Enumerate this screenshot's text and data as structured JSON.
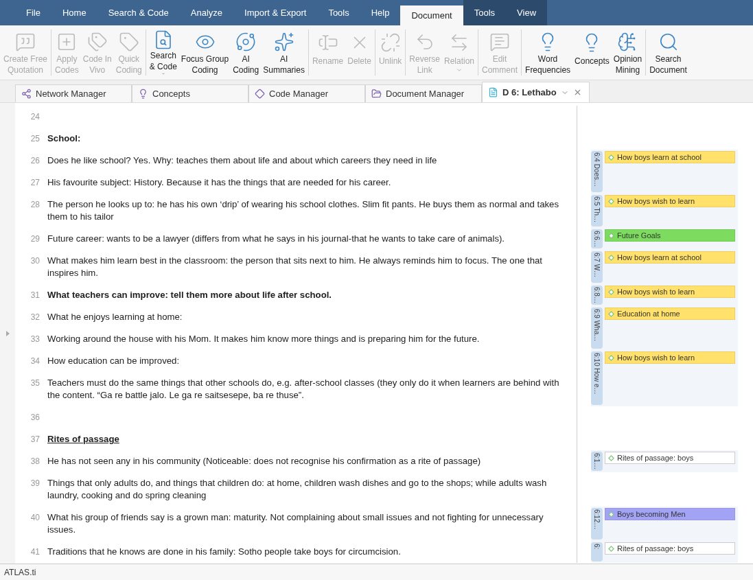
{
  "menu": [
    {
      "label": "File",
      "selected": false,
      "context": false
    },
    {
      "label": "Home",
      "selected": false,
      "context": false
    },
    {
      "label": "Search & Code",
      "selected": false,
      "context": false
    },
    {
      "label": "Analyze",
      "selected": false,
      "context": false
    },
    {
      "label": "Import & Export",
      "selected": false,
      "context": false
    },
    {
      "label": "Tools",
      "selected": false,
      "context": false
    },
    {
      "label": "Help",
      "selected": false,
      "context": false
    },
    {
      "label": "Document",
      "selected": true,
      "context": true
    },
    {
      "label": "Tools",
      "selected": false,
      "context": true
    },
    {
      "label": "View",
      "selected": false,
      "context": true
    }
  ],
  "ribbon": [
    {
      "buttons": [
        {
          "lines": [
            "Create Free",
            "Quotation"
          ],
          "disabled": true,
          "dropdown": false
        }
      ]
    },
    {
      "buttons": [
        {
          "lines": [
            "Apply",
            "Codes"
          ],
          "disabled": true,
          "dropdown": false
        },
        {
          "lines": [
            "Code In",
            "Vivo"
          ],
          "disabled": true,
          "dropdown": false
        },
        {
          "lines": [
            "Quick",
            "Coding"
          ],
          "disabled": true,
          "dropdown": false
        }
      ]
    },
    {
      "buttons": [
        {
          "lines": [
            "Search",
            "& Code"
          ],
          "disabled": false,
          "dropdown": true
        },
        {
          "lines": [
            "Focus Group",
            "Coding"
          ],
          "disabled": false,
          "dropdown": false
        },
        {
          "lines": [
            "AI",
            "Coding"
          ],
          "disabled": false,
          "dropdown": false
        },
        {
          "lines": [
            "AI",
            "Summaries"
          ],
          "disabled": false,
          "dropdown": false
        }
      ]
    },
    {
      "buttons": [
        {
          "lines": [
            "Rename"
          ],
          "disabled": true,
          "dropdown": false
        },
        {
          "lines": [
            "Delete"
          ],
          "disabled": true,
          "dropdown": false
        }
      ]
    },
    {
      "buttons": [
        {
          "lines": [
            "Unlink"
          ],
          "disabled": true,
          "dropdown": false
        }
      ]
    },
    {
      "buttons": [
        {
          "lines": [
            "Reverse",
            "Link"
          ],
          "disabled": true,
          "dropdown": false
        },
        {
          "lines": [
            "Relation"
          ],
          "disabled": true,
          "dropdown": true
        }
      ]
    },
    {
      "buttons": [
        {
          "lines": [
            "Edit",
            "Comment"
          ],
          "disabled": true,
          "dropdown": false
        }
      ]
    },
    {
      "buttons": [
        {
          "lines": [
            "Word",
            "Frequencies"
          ],
          "disabled": false,
          "dropdown": false
        },
        {
          "lines": [
            "Concepts"
          ],
          "disabled": false,
          "dropdown": false
        },
        {
          "lines": [
            "Opinion",
            "Mining"
          ],
          "disabled": false,
          "dropdown": false
        }
      ]
    },
    {
      "buttons": [
        {
          "lines": [
            "Search",
            "Document"
          ],
          "disabled": false,
          "dropdown": false
        }
      ]
    }
  ],
  "doc_tabs": [
    {
      "label": "Network Manager",
      "selected": false
    },
    {
      "label": "Concepts",
      "selected": false
    },
    {
      "label": "Code Manager",
      "selected": false
    },
    {
      "label": "Document Manager",
      "selected": false
    },
    {
      "label": "D 6: Lethabo",
      "selected": true
    }
  ],
  "segments": [
    {
      "lines": [
        {
          "number": "24"
        },
        {
          "number": "25",
          "text": "School:",
          "kind": "emphasis"
        }
      ]
    },
    {
      "quotation": {
        "label": "6:4 Does…",
        "code": "How boys learn at school",
        "color": "#ffe16b"
      },
      "lines": [
        {
          "number": "26",
          "text": "Does he like school? Yes. Why: teaches them about life and about which careers they need in life",
          "kind": "plain"
        },
        {
          "number": "27",
          "text": "His favourite subject: History. Because it has the things that are needed for his career.",
          "kind": "plain"
        }
      ]
    },
    {
      "quotation": {
        "label": "6:5 Th…",
        "code": "How boys wish to learn",
        "color": "#ffe16b"
      },
      "lines": [
        {
          "number": "28",
          "text": "The person he looks up to: he has his own ‘drip’ of wearing his school clothes. Slim fit pants. He buys them as normal and takes them to his tailor",
          "kind": "plain"
        }
      ]
    },
    {
      "quotation": {
        "label": "6:6…",
        "code": "Future Goals",
        "color": "#7ddc5f"
      },
      "lines": [
        {
          "number": "29",
          "text": "Future career: wants to be a lawyer (differs from what he says in his journal-that he wants to take care of animals).",
          "kind": "plain"
        }
      ]
    },
    {
      "quotation": {
        "label": "6:7 W…",
        "code": "How boys learn at school",
        "color": "#ffe16b"
      },
      "lines": [
        {
          "number": "30",
          "text": "What makes him learn best in the classroom: the person that sits next to him. He always reminds him to focus. The one that inspires him.",
          "kind": "plain"
        }
      ]
    },
    {
      "quotation": {
        "label": "6:8…",
        "code": "How boys wish to learn",
        "color": "#ffe16b"
      },
      "lines": [
        {
          "number": "31",
          "text": "What teachers can improve: tell them more about life after school.",
          "kind": "emphasis"
        }
      ]
    },
    {
      "quotation": {
        "label": "6:9 Wha…",
        "code": "Education at home",
        "color": "#ffe16b"
      },
      "lines": [
        {
          "number": "32",
          "text": "What he enjoys learning at home:",
          "kind": "plain"
        },
        {
          "number": "33",
          "text": "Working around the house with his Mom. It makes him know more things and is preparing him for the future.",
          "kind": "plain"
        }
      ]
    },
    {
      "quotation": {
        "label": "6:10 How e…",
        "code": "How boys wish to learn",
        "color": "#ffe16b"
      },
      "lines": [
        {
          "number": "34",
          "text": "How education can be improved:",
          "kind": "plain"
        },
        {
          "number": "35",
          "text": "Teachers must do the same things that other schools do, e.g. after-school classes (they only do it when learners are behind with the content. “Ga re battle jalo. Le ga re saitsesepe, ba re thuse”.",
          "kind": "plain"
        }
      ]
    },
    {
      "lines": [
        {
          "number": "36"
        },
        {
          "number": "37",
          "text": "Rites of passage",
          "kind": "heading"
        }
      ]
    },
    {
      "quotation": {
        "label": "6:1…",
        "code": "Rites of passage: boys",
        "color": "#ffffff"
      },
      "lines": [
        {
          "number": "38",
          "text": "He has not seen any in his community (Noticeable: does not recognise his confirmation as a rite of passage)",
          "kind": "plain"
        }
      ]
    },
    {
      "lines": [
        {
          "number": "39",
          "text": "Things that only adults do, and things that children do: at home, children wash dishes and go to the shops; while adults wash laundry, cooking and do spring cleaning",
          "kind": "plain"
        }
      ]
    },
    {
      "quotation": {
        "label": "6:12…",
        "code": "Boys becoming Men",
        "color": "#a3a3f5"
      },
      "lines": [
        {
          "number": "40",
          "text": "What his group of friends say is a grown man: maturity. Not complaining about small issues and not fighting for unnecessary issues.",
          "kind": "plain"
        }
      ]
    },
    {
      "quotation": {
        "label": "6:",
        "code": "Rites of passage: boys",
        "color": "#ffffff"
      },
      "lines": [
        {
          "number": "41",
          "text": "Traditions that he knows are done in his family: Sotho people take boys for circumcision.",
          "kind": "plain"
        }
      ]
    }
  ],
  "status_bar": "ATLAS.ti"
}
